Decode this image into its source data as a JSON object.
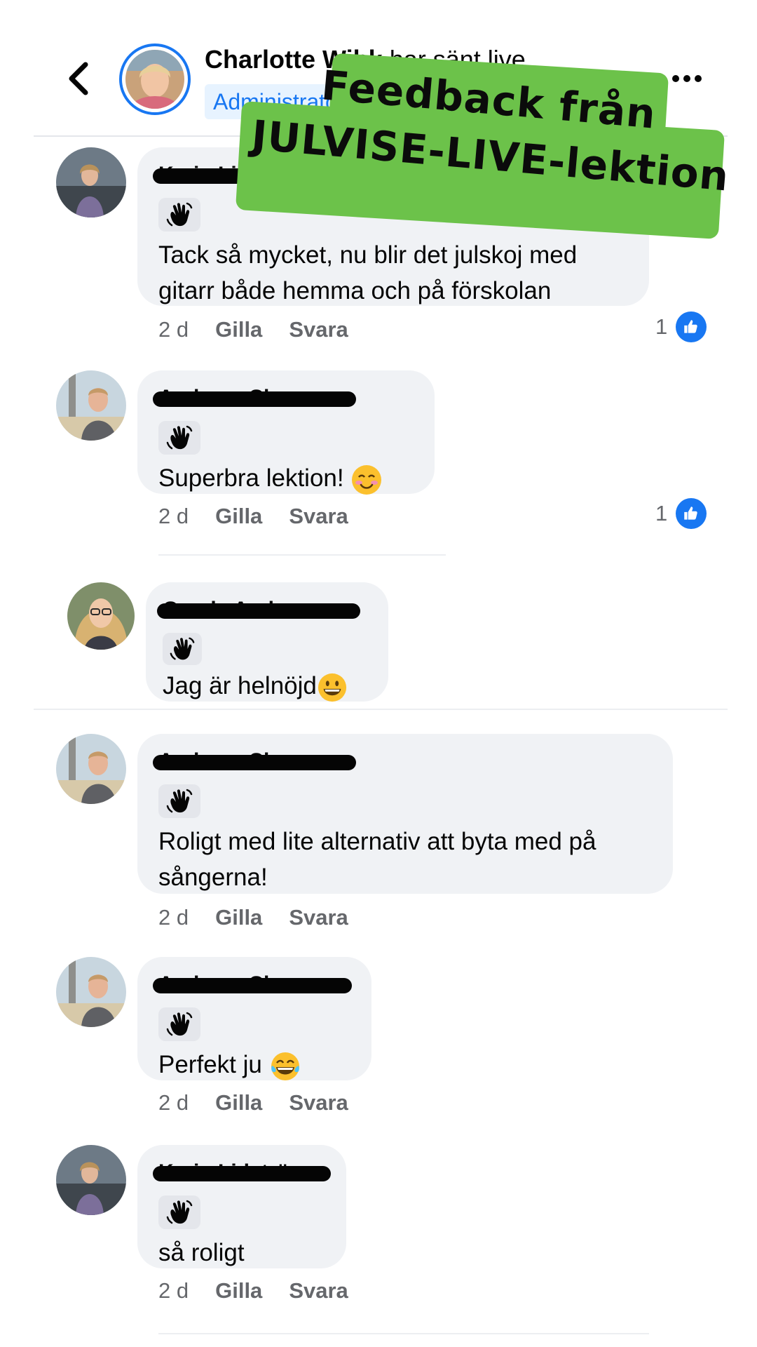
{
  "header": {
    "author_name": "Charlotte Wihk",
    "author_suffix": " har sänt live.",
    "role_badge": "Administratör"
  },
  "overlay": {
    "line1": "Feedback från",
    "line2": "JULVISE-LIVE-lektion",
    "color": "#6cc24a"
  },
  "comments": [
    {
      "name": "Karin Lidström",
      "text_line1": "Tack så mycket, nu blir det julskoj med",
      "text_line2": "gitarr både hemma och på förskolan",
      "time": "2 d",
      "like_label": "Gilla",
      "reply_label": "Svara",
      "reactions": "1"
    },
    {
      "name": "Andreas Classon",
      "text": "Superbra lektion! ",
      "emoji": "smiling-blush-emoji",
      "time": "2 d",
      "like_label": "Gilla",
      "reply_label": "Svara",
      "reactions": "1"
    },
    {
      "name": "Carola Andersson",
      "text": "Jag är helnöjd",
      "emoji": "grinning-emoji"
    },
    {
      "name": "Andreas Classon",
      "text_line1": "Roligt med lite alternativ att byta med på",
      "text_line2": "sångerna!",
      "time": "2 d",
      "like_label": "Gilla",
      "reply_label": "Svara"
    },
    {
      "name": "Andreas Classon",
      "text": "Perfekt ju ",
      "emoji": "tears-of-joy-emoji",
      "time": "2 d",
      "like_label": "Gilla",
      "reply_label": "Svara"
    },
    {
      "name": "Karin Lidström",
      "text": "så roligt",
      "time": "2 d",
      "like_label": "Gilla",
      "reply_label": "Svara"
    }
  ],
  "colors": {
    "accent": "#1877f2",
    "bubble": "#f0f2f5",
    "meta_text": "#65676b"
  }
}
